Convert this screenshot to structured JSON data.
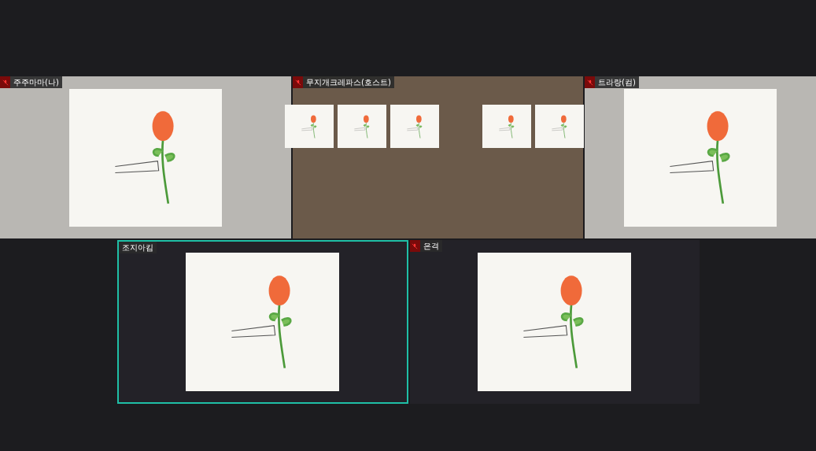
{
  "rows": [
    {
      "tiles": [
        {
          "name": "주주마마(나)",
          "muted": true,
          "active_speaker": false,
          "kind": "camera_with_card"
        },
        {
          "name": "무지개크레파스(호스트)",
          "muted": true,
          "active_speaker": false,
          "kind": "camera_with_thumbnails"
        },
        {
          "name": "트라랑(컴)",
          "muted": true,
          "active_speaker": false,
          "kind": "camera_with_card"
        }
      ]
    },
    {
      "tiles": [
        {
          "name": "조지아킴",
          "muted": false,
          "active_speaker": true,
          "kind": "card"
        },
        {
          "name": "은격",
          "muted": true,
          "active_speaker": false,
          "kind": "card"
        }
      ]
    }
  ]
}
